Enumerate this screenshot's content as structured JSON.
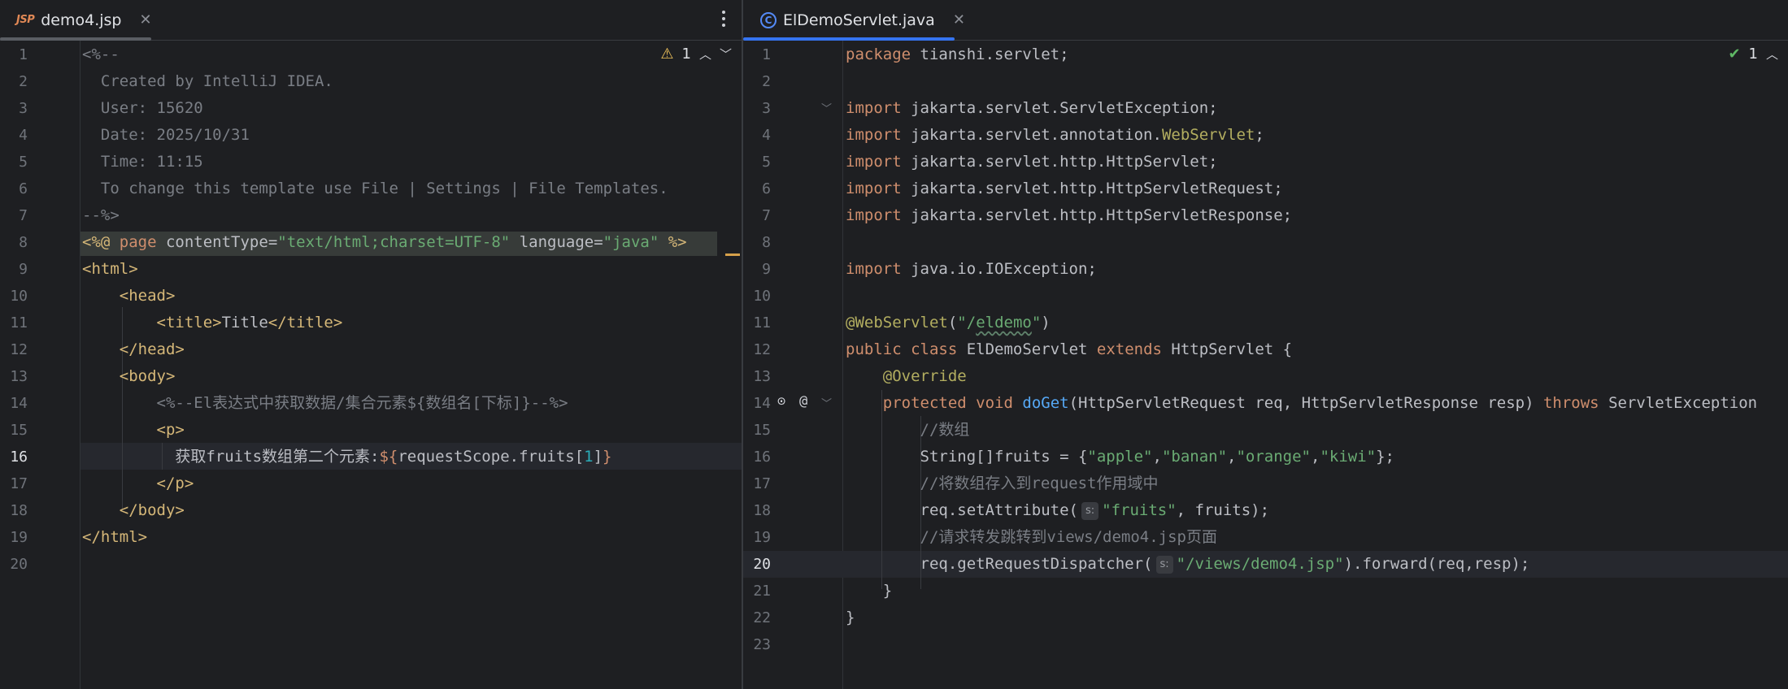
{
  "left_tab": {
    "icon": "jsp-file-icon",
    "icon_text": "JSP",
    "name": "demo4.jsp",
    "close": "✕"
  },
  "right_tab": {
    "icon": "java-class-icon",
    "icon_text": "C",
    "name": "ElDemoServlet.java",
    "close": "✕"
  },
  "left_editor": {
    "inspections": {
      "icon": "warning-icon",
      "count": "1"
    },
    "current_line": "16",
    "line_numbers": [
      "1",
      "2",
      "3",
      "4",
      "5",
      "6",
      "7",
      "8",
      "9",
      "10",
      "11",
      "12",
      "13",
      "14",
      "15",
      "16",
      "17",
      "18",
      "19",
      "20"
    ],
    "lines": [
      "<%--",
      "  Created by IntelliJ IDEA.",
      "  User: 15620",
      "  Date: 2025/10/31",
      "  Time: 11:15",
      "  To change this template use File | Settings | File Templates.",
      "--%>",
      "<%@ page contentType=\"text/html;charset=UTF-8\" language=\"java\" %>",
      "<html>",
      "    <head>",
      "        <title>Title</title>",
      "    </head>",
      "    <body>",
      "        <%--El表达式中获取数据/集合元素${数组名[下标]}--%>",
      "        <p>",
      "          获取fruits数组第二个元素:${requestScope.fruits[1]}",
      "        </p>",
      "    </body>",
      "</html>",
      ""
    ]
  },
  "right_editor": {
    "inspections": {
      "icon": "check-icon",
      "count": "1"
    },
    "current_line": "20",
    "gutter_icons": [
      "override-icon",
      "request-mapping-icon"
    ],
    "line_numbers": [
      "1",
      "2",
      "3",
      "4",
      "5",
      "6",
      "7",
      "8",
      "9",
      "10",
      "11",
      "12",
      "13",
      "14",
      "15",
      "16",
      "17",
      "18",
      "19",
      "20",
      "21",
      "22",
      "23"
    ],
    "lines": [
      "package tianshi.servlet;",
      "",
      "import jakarta.servlet.ServletException;",
      "import jakarta.servlet.annotation.WebServlet;",
      "import jakarta.servlet.http.HttpServlet;",
      "import jakarta.servlet.http.HttpServletRequest;",
      "import jakarta.servlet.http.HttpServletResponse;",
      "",
      "import java.io.IOException;",
      "",
      "@WebServlet(\"/eldemo\")",
      "public class ElDemoServlet extends HttpServlet {",
      "    @Override",
      "    protected void doGet(HttpServletRequest req, HttpServletResponse resp) throws ServletException",
      "        //数组",
      "        String[]fruits = {\"apple\",\"banan\",\"orange\",\"kiwi\"};",
      "        //将数组存入到request作用域中",
      "        req.setAttribute(s: \"fruits\", fruits);",
      "        //请求转发跳转到views/demo4.jsp页面",
      "        req.getRequestDispatcher(s: \"/views/demo4.jsp\").forward(req,resp);",
      "    }",
      "}",
      ""
    ],
    "param_hint": "s:"
  },
  "colors": {
    "background": "#1e1f22",
    "keyword": "#cf8e6d",
    "string": "#6aab73",
    "comment": "#7a7e85",
    "tag": "#d5b778",
    "annotation": "#b3ae60",
    "method": "#56a8f5",
    "number": "#2aacb8",
    "accent": "#3574f0"
  }
}
